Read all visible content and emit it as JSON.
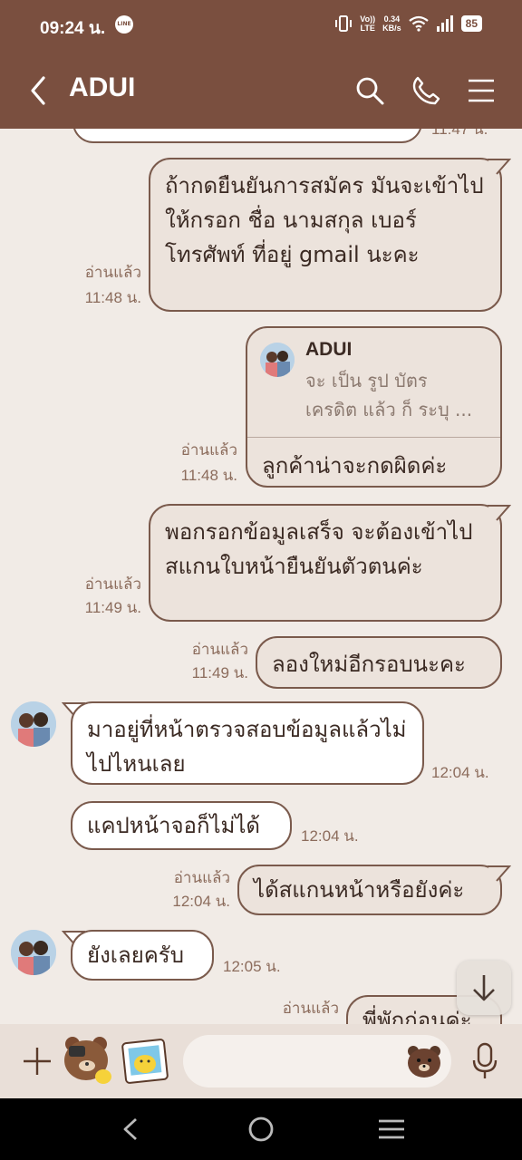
{
  "status_bar": {
    "time": "09:24 น.",
    "app_badge": "LINE",
    "lte_line1": "Vo))",
    "lte_line2": "LTE",
    "speed_line1": "0.34",
    "speed_line2": "KB/s",
    "battery": "85"
  },
  "header": {
    "title": "ADUI"
  },
  "messages": {
    "m0_time": "11:47 น.",
    "m1_text": "ถ้ากดยืนยันการสมัคร มันจะเข้าไปให้กรอก ชื่อ นามสกุล เบอร์โทรศัพท์ ที่อยู่ gmail นะคะ",
    "m1_read": "อ่านแล้ว",
    "m1_time": "11:48 น.",
    "m2_quote_name": "ADUI",
    "m2_quote_text": "จะ เป็น รูป บัตร เครดิต แล้ว ก็ ระบุ ...",
    "m2_text": "ลูกค้าน่าจะกดผิดค่ะ",
    "m2_read": "อ่านแล้ว",
    "m2_time": "11:48 น.",
    "m3_text": "พอกรอกข้อมูลเสร็จ จะต้องเข้าไปสแกนใบหน้ายืนยันตัวตนค่ะ",
    "m3_read": "อ่านแล้ว",
    "m3_time": "11:49 น.",
    "m4_text": "ลองใหม่อีกรอบนะคะ",
    "m4_read": "อ่านแล้ว",
    "m4_time": "11:49 น.",
    "m5_text": "มาอยู่ที่หน้าตรวจสอบข้อมูลแล้วไม่ไปไหนเลย",
    "m5_time": "12:04 น.",
    "m6_text": "แคปหน้าจอก็ไม่ได้",
    "m6_time": "12:04 น.",
    "m7_text": "ได้สแกนหน้าหรือยังค่ะ",
    "m7_read": "อ่านแล้ว",
    "m7_time": "12:04 น.",
    "m8_text": "ยังเลยครับ",
    "m8_time": "12:05 น.",
    "m9_text": "พี่พักก่อนค่ะ",
    "m9_read": "อ่านแล้ว"
  },
  "colors": {
    "header_brown": "#7a4f3f",
    "chat_bg": "#f1ebe6",
    "bubble_sent": "#ece3dc",
    "bubble_received": "#ffffff",
    "bubble_border": "#7a5a4c"
  }
}
